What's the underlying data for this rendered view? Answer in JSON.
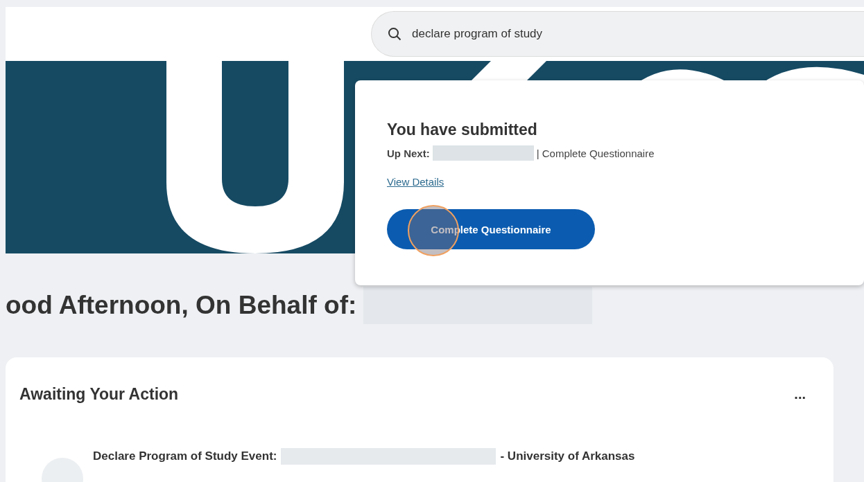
{
  "search": {
    "value": "declare program of study"
  },
  "popup": {
    "title": "You have submitted",
    "up_next_label": "Up Next:",
    "up_next_task": "| Complete Questionnaire",
    "link": "View Details",
    "button": "Complete Questionnaire"
  },
  "greeting": "ood Afternoon, On Behalf of:",
  "awaiting": {
    "title": "Awaiting Your Action",
    "more": "...",
    "items": [
      {
        "title": "Declare Program of Study Event:",
        "suffix": "- University of Arkansas"
      }
    ]
  }
}
